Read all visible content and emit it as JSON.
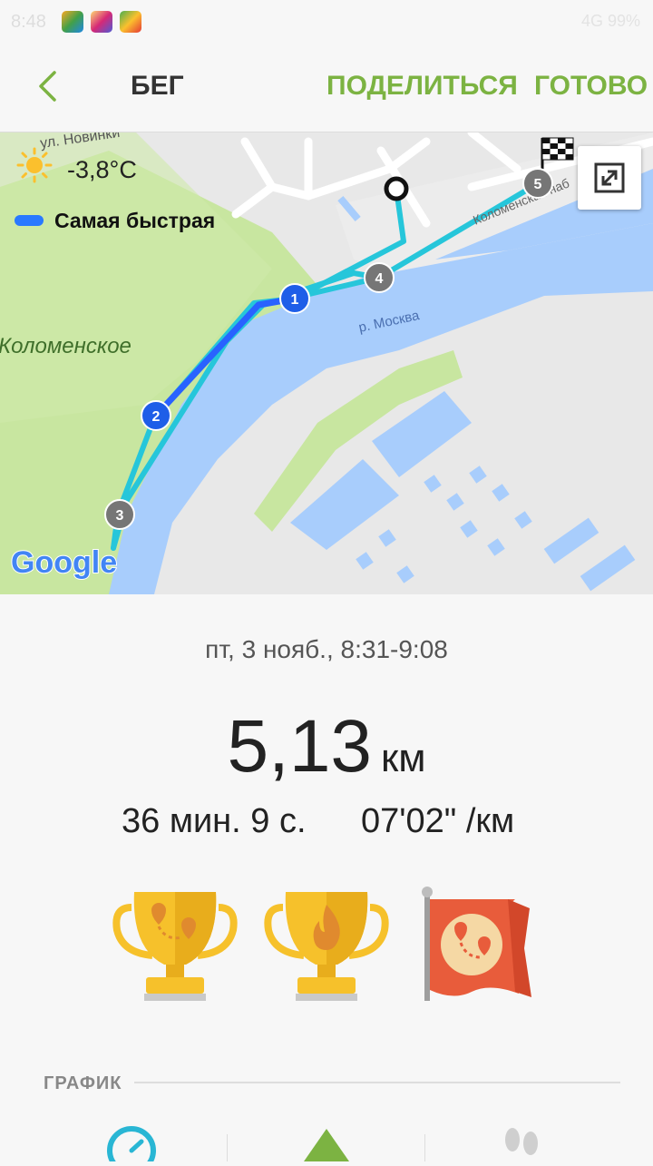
{
  "status_bar": {
    "time": "8:48",
    "right": "4G 99%"
  },
  "header": {
    "title": "БЕГ",
    "share_label": "ПОДЕЛИТЬСЯ",
    "done_label": "ГОТОВО"
  },
  "map": {
    "weather": {
      "temperature": "-3,8°C"
    },
    "legend": {
      "label": "Самая быстрая"
    },
    "labels": {
      "street": "ул. Новинки",
      "park": "Коломенское",
      "river": "р. Москва",
      "embankment": "Коломенская наб"
    },
    "markers": [
      "1",
      "2",
      "3",
      "4",
      "5"
    ],
    "attribution": "Google",
    "colors": {
      "route_fastest": "#2979ff",
      "route": "#26c6da",
      "water": "#a8cdfc",
      "park": "#c8e6a0"
    }
  },
  "workout": {
    "date": "пт, 3 нояб., 8:31-9:08",
    "distance_value": "5,13",
    "distance_unit": "км",
    "duration": "36 мин. 9 с.",
    "pace": "07'02\" /км"
  },
  "achievements": [
    {
      "icon": "trophy-route-icon"
    },
    {
      "icon": "trophy-calories-icon"
    },
    {
      "icon": "flag-route-icon"
    }
  ],
  "section": {
    "title": "ГРАФИК"
  },
  "bottom_tabs": [
    {
      "icon": "speed-icon"
    },
    {
      "icon": "elevation-icon"
    },
    {
      "icon": "steps-icon"
    }
  ]
}
